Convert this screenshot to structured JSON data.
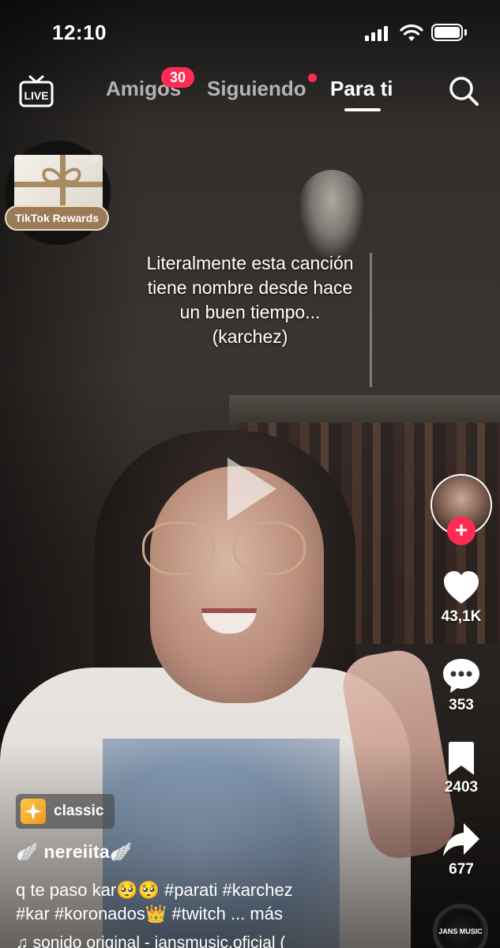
{
  "status_bar": {
    "time": "12:10",
    "battery_level": 1.0
  },
  "top_nav": {
    "live_label": "LIVE",
    "tabs": [
      {
        "label": "Amigos",
        "badge": "30"
      },
      {
        "label": "Siguiendo",
        "dot": true
      },
      {
        "label": "Para ti",
        "active": true
      }
    ]
  },
  "rewards": {
    "label": "TikTok Rewards",
    "close": "×"
  },
  "video": {
    "caption_lines": [
      "Literalmente esta canción",
      "tiene nombre desde hace",
      "un buen tiempo...",
      "(karchez)"
    ]
  },
  "actions": {
    "likes": "43,1K",
    "comments": "353",
    "saves": "2403",
    "shares": "677",
    "follow": "+"
  },
  "post": {
    "effect": "classic",
    "username": "🪽 nereiita🪽",
    "description_line1": "q te paso kar🥺🥺 #parati #karchez",
    "description_line2": "#kar #koronados👑 #twitch ... más",
    "sound": "♫ sonido original - jansmusic.oficial (",
    "disc_label": "JANS MUSIC"
  },
  "colors": {
    "accent": "#fe2c55",
    "text": "#ffffff"
  }
}
